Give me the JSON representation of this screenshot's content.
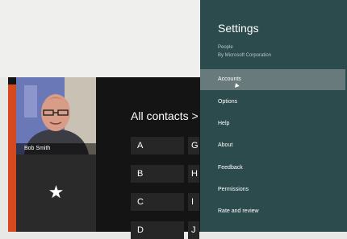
{
  "colors": {
    "accent": "#d6481d",
    "settings_bg": "#2b4b4d",
    "selected_item_bg": "#687a7b"
  },
  "profile": {
    "name": "Bob Smith"
  },
  "favorites": {
    "icon": "star-icon",
    "glyph": "★"
  },
  "contacts": {
    "heading": "All contacts >",
    "letters_col1": [
      "A",
      "B",
      "C",
      "D"
    ],
    "letters_col2": [
      "G",
      "H",
      "I",
      "J"
    ]
  },
  "settings": {
    "title": "Settings",
    "app_name": "People",
    "publisher": "By Microsoft Corporation",
    "items": [
      "Accounts",
      "Options",
      "Help",
      "About",
      "Feedback",
      "Permissions",
      "Rate and review"
    ],
    "selected": "Accounts"
  }
}
